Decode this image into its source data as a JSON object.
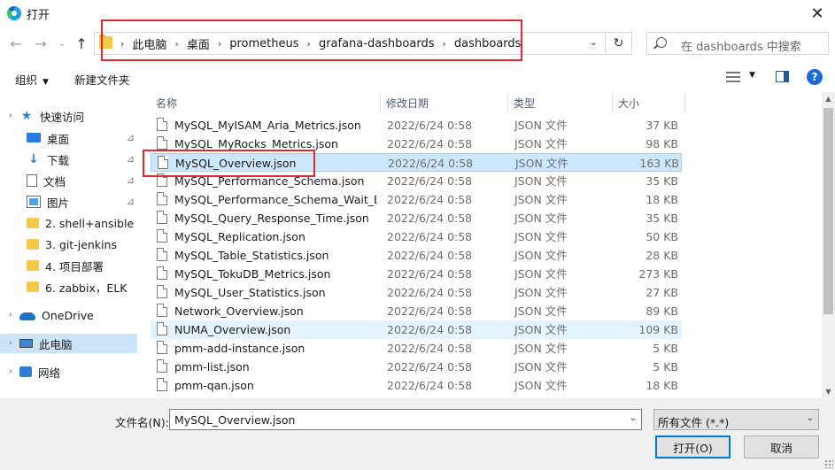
{
  "window": {
    "title": "打开",
    "close": "✕"
  },
  "address": {
    "breadcrumbs": [
      "此电脑",
      "桌面",
      "prometheus",
      "grafana-dashboards",
      "dashboards"
    ],
    "separator": "›",
    "dropdown": "⌄",
    "refresh": "↻"
  },
  "nav": {
    "back": "←",
    "forward": "→",
    "recent": "⌄",
    "up": "↑"
  },
  "search": {
    "placeholder": "在 dashboards 中搜索"
  },
  "toolbar": {
    "organize": "组织",
    "organize_caret": "▼",
    "new_folder": "新建文件夹",
    "view_caret": "▼",
    "help": "?"
  },
  "sidebar": {
    "items": [
      {
        "label": "快速访问",
        "icon": "star-icon"
      },
      {
        "label": "桌面",
        "icon": "desktop-icon",
        "pinned": true
      },
      {
        "label": "下载",
        "icon": "download-icon",
        "pinned": true
      },
      {
        "label": "文档",
        "icon": "document-icon",
        "pinned": true
      },
      {
        "label": "图片",
        "icon": "pictures-icon",
        "pinned": true
      },
      {
        "label": "2. shell+ansible",
        "icon": "folder-icon"
      },
      {
        "label": "3. git-jenkins",
        "icon": "folder-icon"
      },
      {
        "label": "4. 项目部署",
        "icon": "folder-icon"
      },
      {
        "label": "6. zabbix，ELK",
        "icon": "folder-icon"
      },
      {
        "label": "OneDrive",
        "icon": "onedrive-icon"
      },
      {
        "label": "此电脑",
        "icon": "this-pc-icon"
      },
      {
        "label": "网络",
        "icon": "network-icon"
      }
    ],
    "pin_glyph": "📌",
    "expand_glyph": "›"
  },
  "columns": {
    "name": "名称",
    "date": "修改日期",
    "type": "类型",
    "size": "大小",
    "sort": "^"
  },
  "files": [
    {
      "name": "MySQL_MyISAM_Aria_Metrics.json",
      "date": "2022/6/24 0:58",
      "type": "JSON 文件",
      "size": "37 KB"
    },
    {
      "name": "MySQL_MyRocks_Metrics.json",
      "date": "2022/6/24 0:58",
      "type": "JSON 文件",
      "size": "98 KB"
    },
    {
      "name": "MySQL_Overview.json",
      "date": "2022/6/24 0:58",
      "type": "JSON 文件",
      "size": "163 KB"
    },
    {
      "name": "MySQL_Performance_Schema.json",
      "date": "2022/6/24 0:58",
      "type": "JSON 文件",
      "size": "35 KB"
    },
    {
      "name": "MySQL_Performance_Schema_Wait_E...",
      "date": "2022/6/24 0:58",
      "type": "JSON 文件",
      "size": "18 KB"
    },
    {
      "name": "MySQL_Query_Response_Time.json",
      "date": "2022/6/24 0:58",
      "type": "JSON 文件",
      "size": "35 KB"
    },
    {
      "name": "MySQL_Replication.json",
      "date": "2022/6/24 0:58",
      "type": "JSON 文件",
      "size": "50 KB"
    },
    {
      "name": "MySQL_Table_Statistics.json",
      "date": "2022/6/24 0:58",
      "type": "JSON 文件",
      "size": "28 KB"
    },
    {
      "name": "MySQL_TokuDB_Metrics.json",
      "date": "2022/6/24 0:58",
      "type": "JSON 文件",
      "size": "273 KB"
    },
    {
      "name": "MySQL_User_Statistics.json",
      "date": "2022/6/24 0:58",
      "type": "JSON 文件",
      "size": "27 KB"
    },
    {
      "name": "Network_Overview.json",
      "date": "2022/6/24 0:58",
      "type": "JSON 文件",
      "size": "89 KB"
    },
    {
      "name": "NUMA_Overview.json",
      "date": "2022/6/24 0:58",
      "type": "JSON 文件",
      "size": "109 KB"
    },
    {
      "name": "pmm-add-instance.json",
      "date": "2022/6/24 0:58",
      "type": "JSON 文件",
      "size": "5 KB"
    },
    {
      "name": "pmm-list.json",
      "date": "2022/6/24 0:58",
      "type": "JSON 文件",
      "size": "5 KB"
    },
    {
      "name": "pmm-qan.json",
      "date": "2022/6/24 0:58",
      "type": "JSON 文件",
      "size": "18 KB"
    }
  ],
  "filename": {
    "label": "文件名(N):",
    "value": "MySQL_Overview.json",
    "caret": "⌄"
  },
  "filetype": {
    "value": "所有文件 (*.*)",
    "caret": "⌄"
  },
  "buttons": {
    "open": "打开(O)",
    "cancel": "取消"
  },
  "scrollbar": {
    "up": "▲",
    "down": "▼"
  },
  "colors": {
    "selection": "#cce8ff",
    "highlight": "#e0282e",
    "accent": "#0078d7"
  }
}
